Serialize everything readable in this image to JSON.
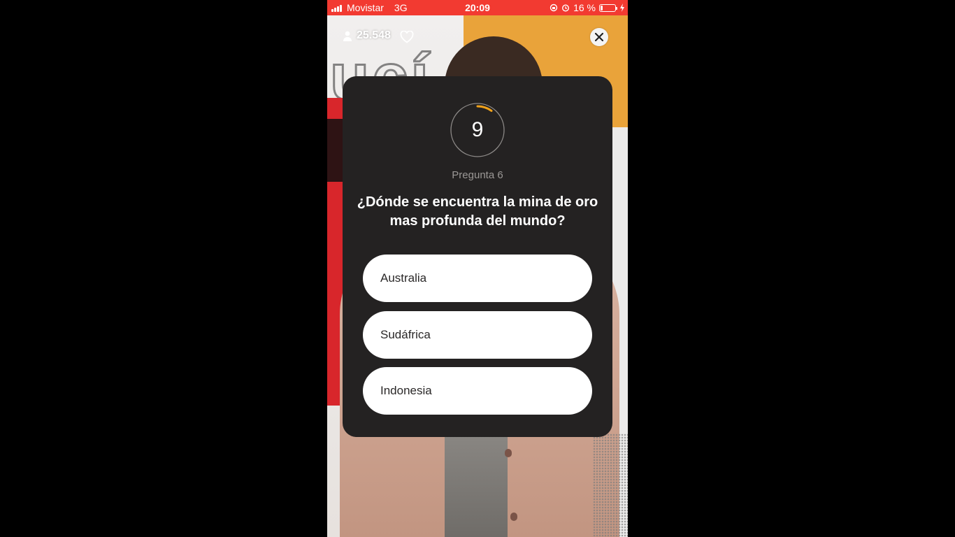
{
  "status_bar": {
    "carrier": "Movistar",
    "network": "3G",
    "time": "20:09",
    "battery": "16 %",
    "battery_level": 0.16,
    "color": "#f23a31"
  },
  "stream": {
    "viewers": "25.548",
    "icons": [
      "person-icon",
      "heart-icon",
      "close-icon"
    ]
  },
  "quiz": {
    "timer": "9",
    "timer_progress": 0.1,
    "timer_color": "#f0a21a",
    "question_label": "Pregunta 6",
    "question": "¿Dónde se encuentra la mina de oro mas profunda del mundo?",
    "answers": [
      {
        "label": "Australia"
      },
      {
        "label": "Sudáfrica"
      },
      {
        "label": "Indonesia"
      }
    ]
  }
}
